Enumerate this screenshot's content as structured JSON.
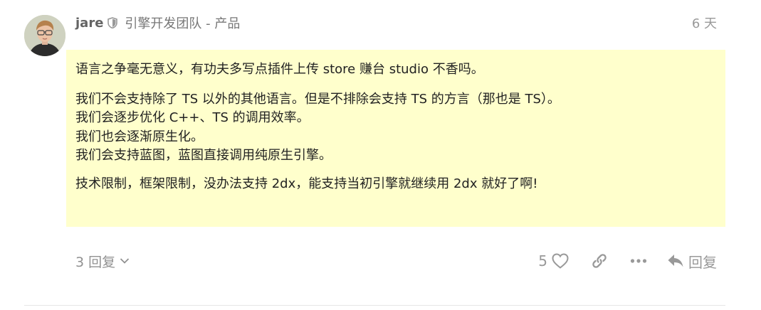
{
  "post": {
    "username": "jare",
    "group": "引擎开发团队 - 产品",
    "date": "6 天",
    "paragraphs": [
      "语言之争毫无意义，有功夫多写点插件上传 store 赚台 studio 不香吗。",
      "我们不会支持除了 TS 以外的其他语言。但是不排除会支持 TS 的方言（那也是 TS）。",
      "我们会逐步优化 C++、TS 的调用效率。",
      "我们也会逐渐原生化。",
      "我们会支持蓝图，蓝图直接调用纯原生引擎。",
      "技术限制，框架限制，没办法支持 2dx，能支持当初引擎就继续用 2dx 就好了啊!"
    ],
    "replies_label": "3 回复",
    "like_count": "5",
    "reply_label": "回复"
  },
  "colors": {
    "highlight_bg": "#ffffcc",
    "muted_text": "#999999"
  },
  "icons": [
    "shield-icon",
    "chevron-down-icon",
    "heart-icon",
    "link-icon",
    "more-icon",
    "reply-icon"
  ]
}
